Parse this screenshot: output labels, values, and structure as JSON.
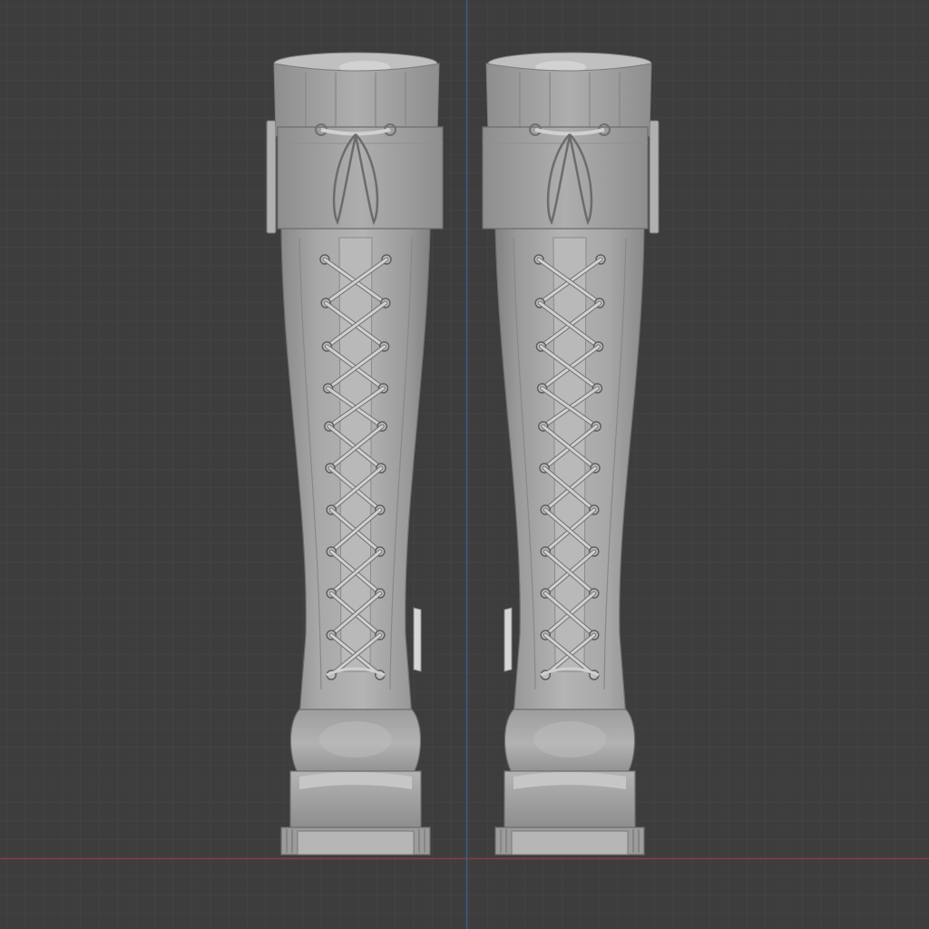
{
  "viewport": {
    "background": "#3d3d3d",
    "grid_minor_color": "#474747",
    "grid_major_color": "#525252",
    "axis_x_color": "#8a3a44",
    "axis_y_color": "#3d5f8f"
  },
  "objects": [
    {
      "name": "left-boot",
      "icon": "boot-icon"
    },
    {
      "name": "right-boot",
      "icon": "boot-icon"
    }
  ],
  "material": {
    "base": "#a6a6a6",
    "light": "#c4c4c4",
    "dark": "#7a7a7a",
    "lace": "#d0d0d0"
  }
}
